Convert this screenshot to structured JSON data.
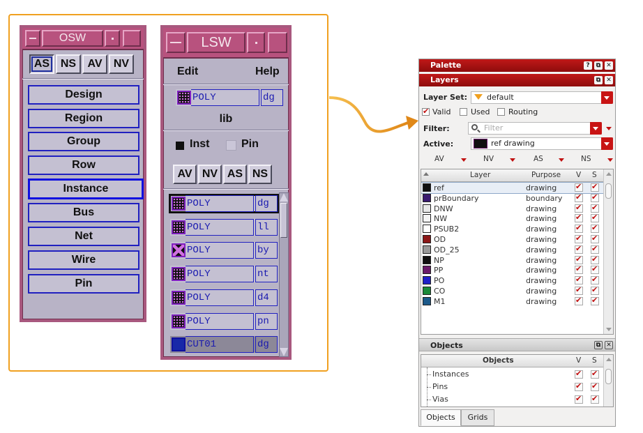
{
  "osw": {
    "title": "OSW",
    "toggles": [
      "AS",
      "NS",
      "AV",
      "NV"
    ],
    "buttons": [
      "Design",
      "Region",
      "Group",
      "Row",
      "Instance",
      "Bus",
      "Net",
      "Wire",
      "Pin"
    ]
  },
  "lsw": {
    "title": "LSW",
    "menu": {
      "edit": "Edit",
      "help": "Help"
    },
    "current": {
      "layer": "POLY",
      "purpose": "dg"
    },
    "lib": "lib",
    "inst_label": "Inst",
    "pin_label": "Pin",
    "buttons": [
      "AV",
      "NV",
      "AS",
      "NS"
    ],
    "layers": [
      {
        "layer": "POLY",
        "purpose": "dg"
      },
      {
        "layer": "POLY",
        "purpose": "ll"
      },
      {
        "layer": "POLY",
        "purpose": "by"
      },
      {
        "layer": "POLY",
        "purpose": "nt"
      },
      {
        "layer": "POLY",
        "purpose": "d4"
      },
      {
        "layer": "POLY",
        "purpose": "pn"
      },
      {
        "layer": "CUT01",
        "purpose": "dg"
      }
    ]
  },
  "palette": {
    "title": "Palette",
    "title_icons": [
      "?",
      "⧉",
      "✕"
    ],
    "layers_title": "Layers",
    "layer_set_label": "Layer Set:",
    "layer_set_value": "default",
    "checks": [
      {
        "label": "Valid",
        "checked": true
      },
      {
        "label": "Used",
        "checked": false
      },
      {
        "label": "Routing",
        "checked": false
      }
    ],
    "filter_label": "Filter:",
    "filter_placeholder": "Filter",
    "active_label": "Active:",
    "active_value": "ref drawing",
    "mode_buttons": [
      "AV",
      "NV",
      "AS",
      "NS"
    ],
    "table_headers": {
      "layer": "Layer",
      "purpose": "Purpose",
      "v": "V",
      "s": "S"
    },
    "rows": [
      {
        "layer": "ref",
        "purpose": "drawing",
        "color": "#101010"
      },
      {
        "layer": "prBoundary",
        "purpose": "boundary",
        "color": "#3a1a70"
      },
      {
        "layer": "DNW",
        "purpose": "drawing",
        "color": "#e8e8e8"
      },
      {
        "layer": "NW",
        "purpose": "drawing",
        "color": "#f4f4f4"
      },
      {
        "layer": "PSUB2",
        "purpose": "drawing",
        "color": "#ffffff"
      },
      {
        "layer": "OD",
        "purpose": "drawing",
        "color": "#8c1818"
      },
      {
        "layer": "OD_25",
        "purpose": "drawing",
        "color": "#9a9a9a"
      },
      {
        "layer": "NP",
        "purpose": "drawing",
        "color": "#101010"
      },
      {
        "layer": "PP",
        "purpose": "drawing",
        "color": "#6a1a6a"
      },
      {
        "layer": "PO",
        "purpose": "drawing",
        "color": "#2020c8"
      },
      {
        "layer": "CO",
        "purpose": "drawing",
        "color": "#1c8a3a"
      },
      {
        "layer": "M1",
        "purpose": "drawing",
        "color": "#1c5a8a"
      }
    ],
    "objects_title": "Objects",
    "objects_header": {
      "name": "Objects",
      "v": "V",
      "s": "S"
    },
    "objects": [
      "Instances",
      "Pins",
      "Vias"
    ],
    "tabs": [
      "Objects",
      "Grids"
    ]
  },
  "colors": {
    "accent_red": "#c01818",
    "frame_orange": "#f0a020",
    "motif_border": "#a8587e"
  }
}
